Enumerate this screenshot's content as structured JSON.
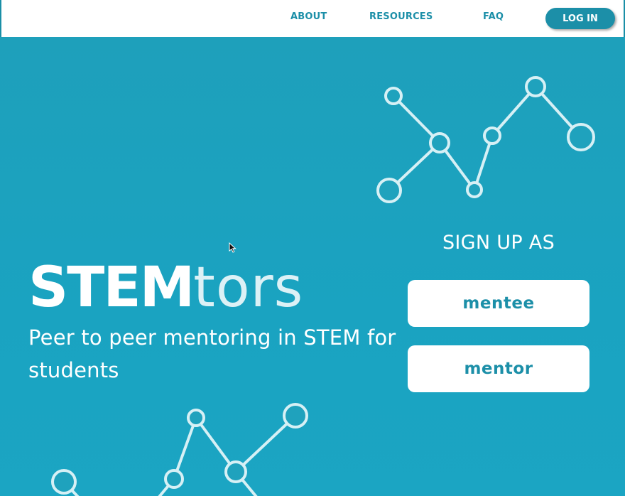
{
  "nav": {
    "about": "ABOUT",
    "resources": "RESOURCES",
    "faq": "FAQ",
    "login": "LOG IN"
  },
  "hero": {
    "brand_bold": "STEM",
    "brand_light": "tors",
    "tagline": "Peer to peer mentoring in STEM for students"
  },
  "signup": {
    "heading": "SIGN UP AS",
    "mentee": "mentee",
    "mentor": "mentor"
  },
  "colors": {
    "brand_teal": "#1ca3c0",
    "nav_text": "#1c8fa8",
    "white": "#ffffff"
  }
}
